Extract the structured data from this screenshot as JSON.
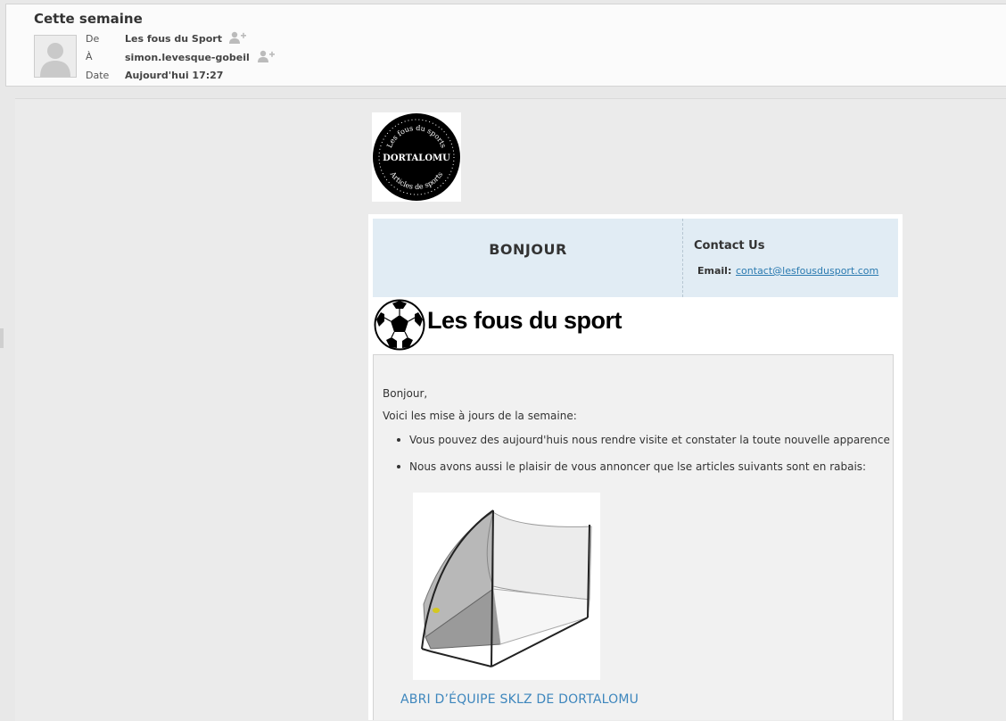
{
  "mail": {
    "subject": "Cette semaine",
    "from_label": "De",
    "from_value": "Les fous du Sport",
    "to_label": "À",
    "to_value": "simon.levesque-gobeil",
    "date_label": "Date",
    "date_value": "Aujourd'hui 17:27"
  },
  "logo": {
    "name": "DORTALOMU",
    "top_arc": "Les fous du sports",
    "bottom_arc": "Articles de sports"
  },
  "header": {
    "greeting": "BONJOUR",
    "contact_title": "Contact Us",
    "email_label": "Email:",
    "email_value": "contact@lesfousdusport.com"
  },
  "brand": {
    "name": "Les fous du sport",
    "icon": "soccer-ball-icon"
  },
  "body": {
    "salutation": "Bonjour,",
    "intro": "Voici les mise à jours de la semaine:",
    "bullets": [
      "Vous pouvez des aujourd'huis nous rendre visite et constater la toute nouvelle apparence",
      "Nous avons aussi le plaisir de vous annoncer que lse articles suivants sont en rabais:"
    ],
    "product_name": "ABRI D’ÉQUIPE SKLZ DE DORTALOMU"
  },
  "colors": {
    "header_bg": "#e1ecf4",
    "link": "#2a7ab0",
    "product_link": "#3d86bd"
  }
}
